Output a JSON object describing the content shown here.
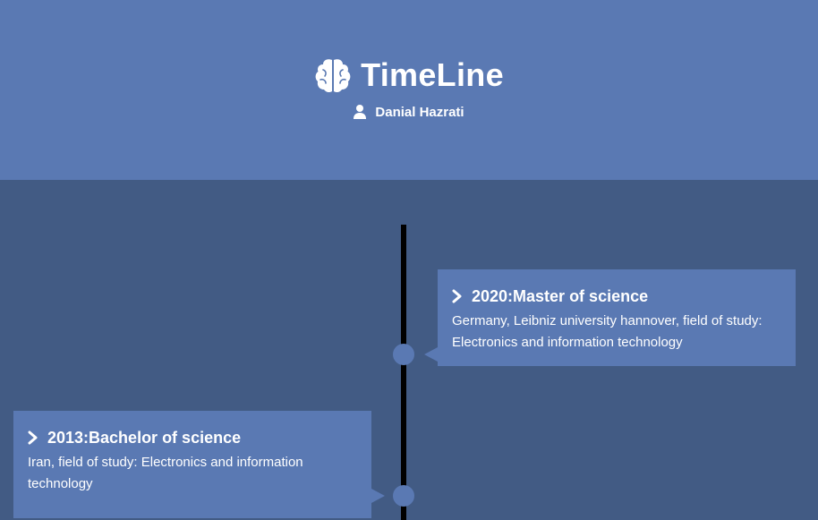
{
  "header": {
    "title": "TimeLine",
    "author": "Danial Hazrati",
    "logo_icon": "brain-icon",
    "author_icon": "user-icon"
  },
  "colors": {
    "header_bg": "#5a79b3",
    "page_bg": "#425b84",
    "card_bg": "#5a79b3",
    "line": "#000000",
    "text": "#ffffff"
  },
  "timeline": {
    "entries": [
      {
        "title": "2020:Master of science",
        "description": "Germany, Leibniz university hannover, field of study: Electronics and information technology",
        "side": "right",
        "icon": "chevron-right-icon"
      },
      {
        "title": "2013:Bachelor of science",
        "description": "Iran, field of study: Electronics and information technology",
        "side": "left",
        "icon": "chevron-right-icon"
      }
    ]
  }
}
